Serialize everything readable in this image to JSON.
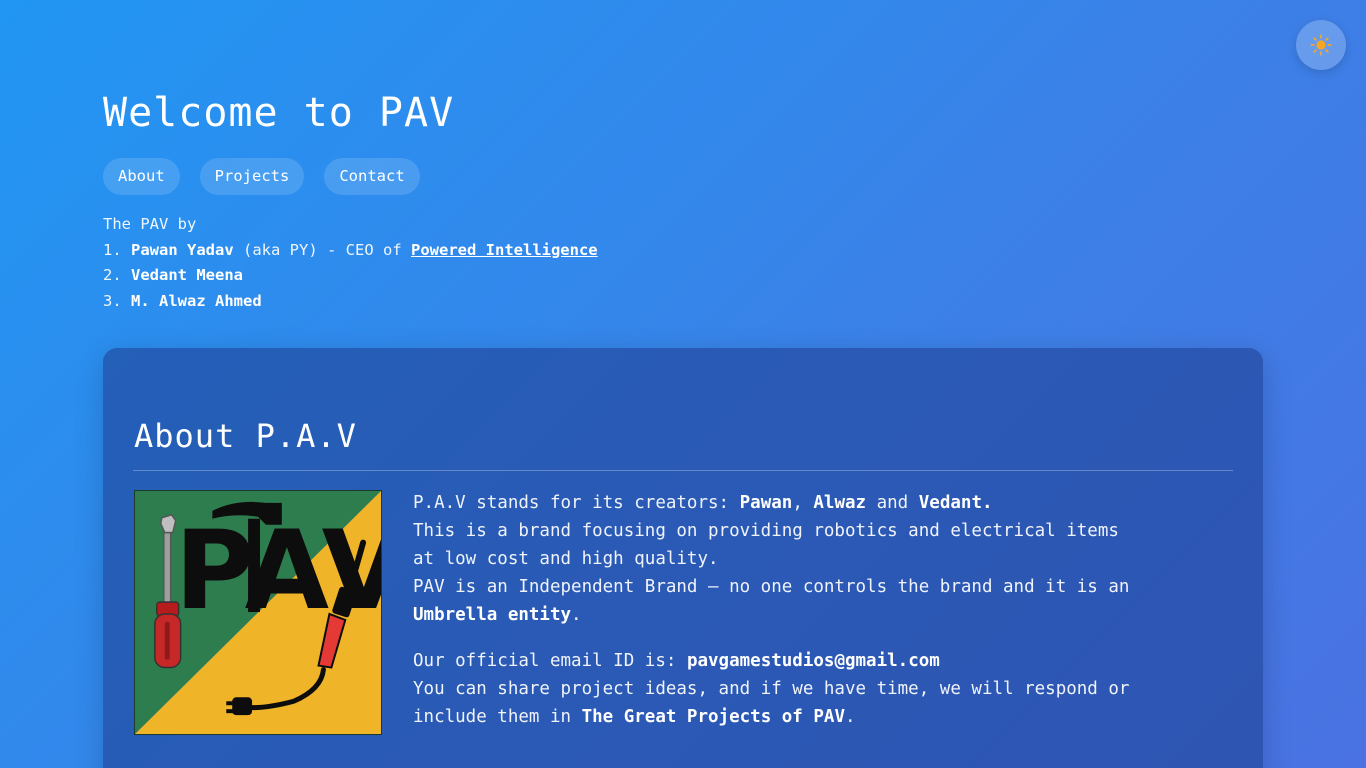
{
  "theme_toggle": {
    "icon": "sun-icon",
    "color": "#f5a623"
  },
  "header": {
    "title": "Welcome to PAV"
  },
  "nav": {
    "items": [
      "About",
      "Projects",
      "Contact"
    ]
  },
  "intro": {
    "line1": "The PAV by",
    "members": [
      {
        "num": "1.",
        "name": "Pawan Yadav",
        "extra": "(aka PY) - CEO of",
        "link": "Powered Intelligence"
      },
      {
        "num": "2.",
        "name": "Vedant Meena"
      },
      {
        "num": "3.",
        "name": "M. Alwaz Ahmed"
      }
    ]
  },
  "about": {
    "title": "About P.A.V",
    "logo": {
      "letters": "PAV",
      "colors": {
        "green": "#2e7d4f",
        "yellow": "#f0b429",
        "red": "#c62828",
        "black": "#0d0d0d"
      }
    },
    "p1": {
      "a": "P.A.V stands for its creators: ",
      "n1": "Pawan",
      "b": ", ",
      "n2": "Alwaz",
      "c": " and ",
      "n3": "Vedant.",
      "line2": "This is a brand focusing on providing robotics and electrical items at low cost and high quality.",
      "line3a": "PAV is an Independent Brand — no one controls the brand and it is an ",
      "line3b": "Umbrella entity",
      "line3c": "."
    },
    "p2": {
      "a": "Our official email ID is: ",
      "email": "pavgamestudios@gmail.com",
      "line2a": "You can share project ideas, and if we have time, we will respond or include them in ",
      "line2b": "The Great Projects of PAV",
      "line2c": "."
    }
  }
}
